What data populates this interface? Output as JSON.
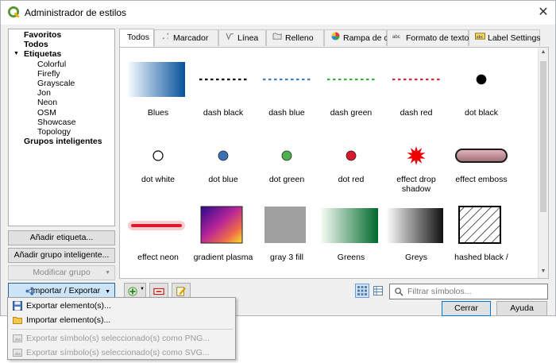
{
  "window": {
    "title": "Administrador de estilos",
    "accent": "#589632"
  },
  "tree": {
    "items": [
      {
        "label": "Favoritos",
        "bold": true,
        "level": 0
      },
      {
        "label": "Todos",
        "bold": true,
        "level": 0
      },
      {
        "label": "Etiquetas",
        "bold": true,
        "level": 0,
        "expanded": true
      },
      {
        "label": "Colorful",
        "bold": false,
        "level": 1
      },
      {
        "label": "Firefly",
        "bold": false,
        "level": 1
      },
      {
        "label": "Grayscale",
        "bold": false,
        "level": 1
      },
      {
        "label": "Jon",
        "bold": false,
        "level": 1
      },
      {
        "label": "Neon",
        "bold": false,
        "level": 1
      },
      {
        "label": "OSM",
        "bold": false,
        "level": 1
      },
      {
        "label": "Showcase",
        "bold": false,
        "level": 1
      },
      {
        "label": "Topology",
        "bold": false,
        "level": 1
      },
      {
        "label": "Grupos inteligentes",
        "bold": true,
        "level": 0
      }
    ]
  },
  "left_buttons": {
    "add_tag": "Añadir etiqueta...",
    "add_smart_group": "Añadir grupo inteligente...",
    "modify_group": "Modificar grupo",
    "import_export": "Importar / Exportar"
  },
  "tabs": [
    {
      "label": "Todos",
      "icon": "none",
      "active": true
    },
    {
      "label": "Marcador",
      "icon": "marker-icon"
    },
    {
      "label": "Línea",
      "icon": "line-icon"
    },
    {
      "label": "Relleno",
      "icon": "fill-icon"
    },
    {
      "label": "Rampa de color",
      "icon": "color-ramp-icon"
    },
    {
      "label": "Formato de texto",
      "icon": "text-format-icon"
    },
    {
      "label": "Label Settings",
      "icon": "label-settings-icon"
    }
  ],
  "symbols": [
    {
      "label": "Blues",
      "kind": "ramp-blues"
    },
    {
      "label": "dash  black",
      "kind": "dash",
      "color": "#000000"
    },
    {
      "label": "dash blue",
      "kind": "dash",
      "color": "#3a7fc1"
    },
    {
      "label": "dash green",
      "kind": "dash",
      "color": "#3aaf3a"
    },
    {
      "label": "dash red",
      "kind": "dash",
      "color": "#e0283c"
    },
    {
      "label": "dot  black",
      "kind": "dot",
      "color": "#000000"
    },
    {
      "label": "dot  white",
      "kind": "dot-white"
    },
    {
      "label": "dot blue",
      "kind": "dot",
      "color": "#3a70b6"
    },
    {
      "label": "dot green",
      "kind": "dot",
      "color": "#4caf50"
    },
    {
      "label": "dot red",
      "kind": "dot",
      "color": "#d9182d"
    },
    {
      "label": "effect drop shadow",
      "kind": "star",
      "color": "#ee0000"
    },
    {
      "label": "effect emboss",
      "kind": "emboss"
    },
    {
      "label": "effect neon",
      "kind": "neon",
      "color": "#dd1a2a"
    },
    {
      "label": "gradient plasma",
      "kind": "plasma"
    },
    {
      "label": "gray 3 fill",
      "kind": "gray-fill"
    },
    {
      "label": "Greens",
      "kind": "ramp-greens"
    },
    {
      "label": "Greys",
      "kind": "ramp-greys"
    },
    {
      "label": "hashed black /",
      "kind": "hashed"
    }
  ],
  "search": {
    "placeholder": "Filtrar símbolos..."
  },
  "dialog_buttons": {
    "close": "Cerrar",
    "help": "Ayuda"
  },
  "import_menu": {
    "items": [
      {
        "label": "Exportar elemento(s)...",
        "icon": "save-icon",
        "enabled": true
      },
      {
        "label": "Importar elemento(s)...",
        "icon": "folder-icon",
        "enabled": true
      },
      {
        "label": "Exportar símbolo(s) seleccionado(s) como PNG...",
        "icon": "export-png-icon",
        "enabled": false
      },
      {
        "label": "Exportar símbolo(s) seleccionado(s) como SVG...",
        "icon": "export-svg-icon",
        "enabled": false
      }
    ]
  }
}
